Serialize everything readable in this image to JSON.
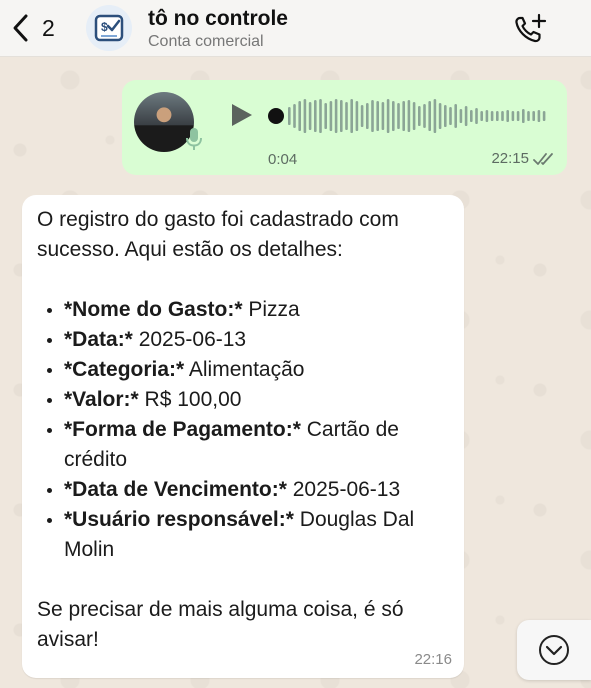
{
  "header": {
    "back_count": "2",
    "title": "tô no controle",
    "subtitle": "Conta comercial",
    "icons": [
      "chevron-left-icon",
      "business-logo-icon",
      "call-add-icon"
    ]
  },
  "audio_message": {
    "duration": "0:04",
    "time": "22:15",
    "status": "read",
    "icons": [
      "play-icon",
      "microphone-icon",
      "double-check-icon"
    ],
    "colors": {
      "bubble": "#d9fdd3",
      "ticks": "#5d6b62"
    }
  },
  "text_message": {
    "intro": "O registro do gasto foi cadastrado com sucesso. Aqui estão os detalhes:",
    "details": [
      {
        "label": "*Nome do Gasto:*",
        "value": " Pizza"
      },
      {
        "label": "*Data:*",
        "value": " 2025-06-13"
      },
      {
        "label": "*Categoria:*",
        "value": " Alimentação"
      },
      {
        "label": "*Valor:*",
        "value": " R$ 100,00"
      },
      {
        "label": "*Forma de Pagamento:*",
        "value": " Cartão de crédito"
      },
      {
        "label": "*Data de Vencimento:*",
        "value": " 2025-06-13"
      },
      {
        "label": "*Usuário responsável:*",
        "value": " Douglas Dal Molin"
      }
    ],
    "outro": "Se precisar de mais alguma coisa, é só avisar!",
    "time": "22:16"
  },
  "scroll_button": {
    "icon": "chevron-down-icon"
  }
}
